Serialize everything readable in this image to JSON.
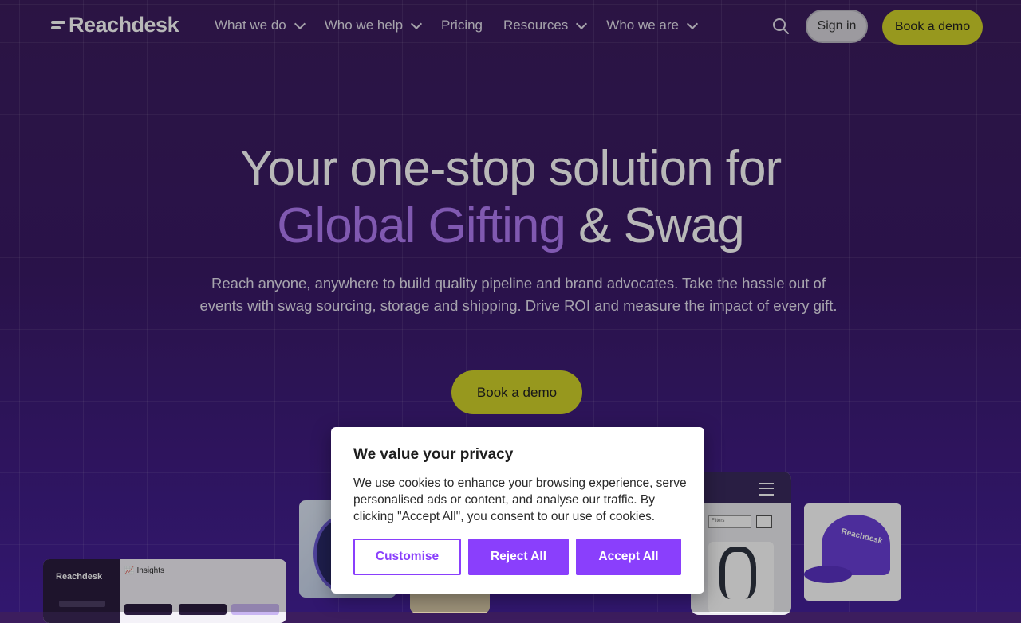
{
  "nav": {
    "logo": "Reachdesk",
    "items": [
      {
        "label": "What we do",
        "dropdown": true
      },
      {
        "label": "Who we help",
        "dropdown": true
      },
      {
        "label": "Pricing",
        "dropdown": false
      },
      {
        "label": "Resources",
        "dropdown": true
      },
      {
        "label": "Who we are",
        "dropdown": true
      }
    ],
    "search_icon": "search-icon",
    "signin_label": "Sign in",
    "demo_label": "Book a demo"
  },
  "hero": {
    "title_line1": "Your one-stop solution for",
    "title_accent": "Global Gifting",
    "title_rest": " & Swag",
    "subtitle": "Reach anyone, anywhere to build quality pipeline and brand advocates. Take the hassle out of events with swag sourcing, storage and shipping. Drive ROI and measure the impact of every gift.",
    "cta_label": "Book a demo"
  },
  "visuals": {
    "dashboard_logo": "Reachdesk",
    "dashboard_title": "Insights",
    "filter_label": "Filters",
    "cap_text": "Reachdesk"
  },
  "cookie": {
    "title": "We value your privacy",
    "text": "We use cookies to enhance your browsing experience, serve personalised ads or content, and analyse our traffic. By clicking \"Accept All\", you consent to our use of cookies.",
    "customise_label": "Customise",
    "reject_label": "Reject All",
    "accept_label": "Accept All"
  },
  "colors": {
    "accent_purple": "#8a3ffc",
    "cta_yellow": "#d2d32a",
    "hero_accent": "#b27cf6"
  }
}
